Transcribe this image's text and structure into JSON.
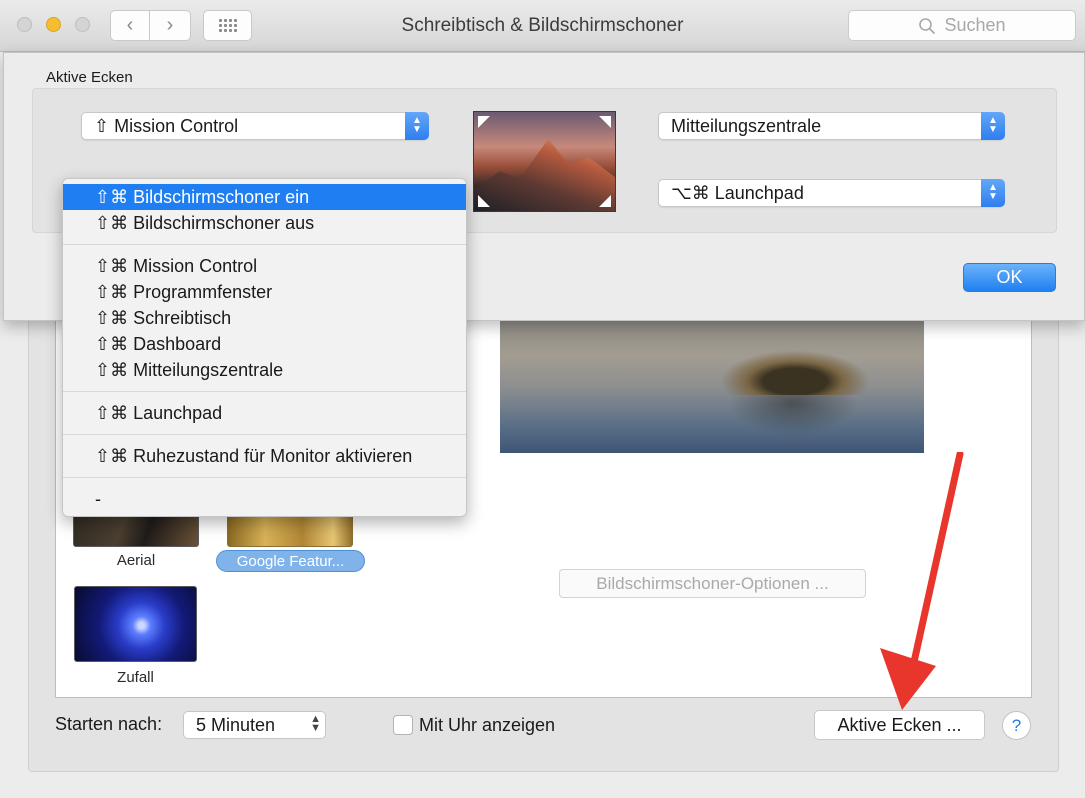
{
  "window": {
    "title": "Schreibtisch & Bildschirmschoner",
    "search_placeholder": "Suchen",
    "nav_back": "‹",
    "nav_forward": "›"
  },
  "screensavers": [
    {
      "name": "Aerial",
      "selected": false
    },
    {
      "name": "Google Featur...",
      "selected": true
    },
    {
      "name": "Zufall",
      "selected": false
    }
  ],
  "preview": {
    "options_button": "Bildschirmschoner-Optionen ..."
  },
  "footer": {
    "start_label": "Starten nach:",
    "start_value": "5 Minuten",
    "clock_label": "Mit Uhr anzeigen",
    "clock_checked": false,
    "hot_corners_button": "Aktive Ecken ...",
    "help": "?"
  },
  "sheet": {
    "title": "Aktive Ecken",
    "top_left": "⇧ Mission Control",
    "top_right": "Mitteilungszentrale",
    "bottom_right": "⌥⌘ Launchpad",
    "ok_button": "OK"
  },
  "menu": {
    "groups": [
      [
        "⇧⌘ Bildschirmschoner ein",
        "⇧⌘ Bildschirmschoner aus"
      ],
      [
        "⇧⌘ Mission Control",
        "⇧⌘ Programmfenster",
        "⇧⌘ Schreibtisch",
        "⇧⌘ Dashboard",
        "⇧⌘ Mitteilungszentrale"
      ],
      [
        "⇧⌘ Launchpad"
      ],
      [
        "⇧⌘ Ruhezustand für Monitor aktivieren"
      ],
      [
        "-"
      ]
    ],
    "selected": "⇧⌘ Bildschirmschoner ein"
  },
  "colors": {
    "accent": "#1f7ef1",
    "annotation_arrow": "#e8362c"
  }
}
